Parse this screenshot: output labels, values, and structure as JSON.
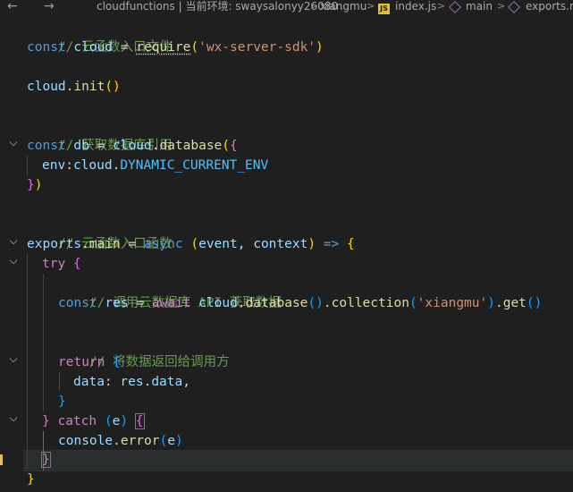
{
  "breadcrumb": {
    "back": "←",
    "forward": "→",
    "folder": "cloudfunctions | 当前环境: swaysalonyy26080",
    "subfolder": "xiangmu",
    "file_badge": "JS",
    "file": "index.js",
    "symbol_main": "main",
    "symbol_exports": "exports.m",
    "sep": ">"
  },
  "gutter": {
    "collapse_glyph": "⌵",
    "expand_glyph": "›"
  },
  "code": {
    "l1": "// 云函数入口文件",
    "l2_const": "const",
    "l2_name": "cloud",
    "l2_eq": "=",
    "l2_require": "require",
    "l2_paren_open": "(",
    "l2_str": "'wx-server-sdk'",
    "l2_paren_close": ")",
    "l4_obj": "cloud",
    "l4_dot": ".",
    "l4_fn": "init",
    "l4_parens": "()",
    "l6": "// 获取数据库引用",
    "l7_const": "const",
    "l7_name": "db",
    "l7_eq": "=",
    "l7_obj": "cloud",
    "l7_dot": ".",
    "l7_fn": "database",
    "l7_paren": "(",
    "l7_brace": "{",
    "l8_key": "env",
    "l8_colon": ":",
    "l8_obj": "cloud",
    "l8_dot": ".",
    "l8_const": "DYNAMIC_CURRENT_ENV",
    "l9_brace": "}",
    "l9_paren": ")",
    "l11": "// 云函数入口函数",
    "l12_exports": "exports",
    "l12_dot": ".",
    "l12_main": "main",
    "l12_eq": "=",
    "l12_async": "async",
    "l12_popen": "(",
    "l12_event": "event",
    "l12_comma": ",",
    "l12_context": "context",
    "l12_pclose": ")",
    "l12_arrow": "=>",
    "l12_brace": "{",
    "l13_try": "try",
    "l13_brace": "{",
    "l14": "// 调用云数据库 API 获取数据",
    "l15_const": "const",
    "l15_name": "res",
    "l15_eq": "=",
    "l15_await": "await",
    "l15_obj": "cloud",
    "l15_dot1": ".",
    "l15_fn1": "database",
    "l15_p1": "()",
    "l15_dot2": ".",
    "l15_fn2": "collection",
    "l15_popen": "(",
    "l15_str": "'xiangmu'",
    "l15_pclose": ")",
    "l15_dot3": ".",
    "l15_fn3": "get",
    "l15_p3": "()",
    "l17": "// 将数据返回给调用方",
    "l18_return": "return",
    "l18_brace": "{",
    "l19_key": "data",
    "l19_colon": ":",
    "l19_obj": "res",
    "l19_dot": ".",
    "l19_prop": "data",
    "l19_comma": ",",
    "l20_brace": "}",
    "l21_brace": "}",
    "l21_catch": "catch",
    "l21_popen": "(",
    "l21_e": "e",
    "l21_pclose": ")",
    "l21_obrace": "{",
    "l22_obj": "console",
    "l22_dot": ".",
    "l22_fn": "error",
    "l22_popen": "(",
    "l22_e": "e",
    "l22_pclose": ")",
    "l23_brace": "}",
    "l24_brace": "}"
  }
}
